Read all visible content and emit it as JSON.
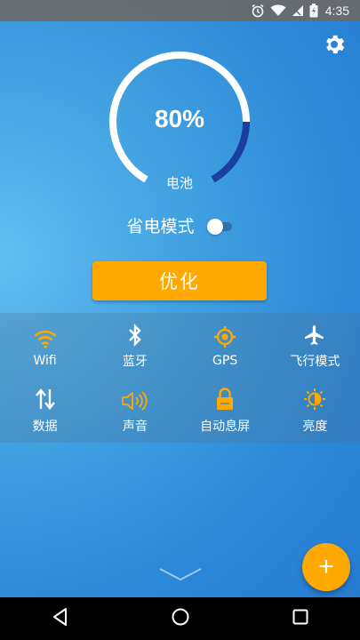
{
  "status_bar": {
    "time": "4:35",
    "icons": [
      "alarm-icon",
      "wifi-icon",
      "signal-icon",
      "battery-icon"
    ]
  },
  "settings": {
    "icon": "gear-icon"
  },
  "battery": {
    "percent_text": "80%",
    "level": 0.8,
    "label": "电池",
    "colors": {
      "track": "#ffffff",
      "fill": "#1a3fa0"
    }
  },
  "power_saving": {
    "label": "省电模式",
    "enabled": false
  },
  "optimize_button": {
    "label": "优化",
    "color": "#ffa800"
  },
  "quick_settings": [
    {
      "label": "Wifi",
      "icon": "wifi-icon",
      "color": "#ffa800"
    },
    {
      "label": "蓝牙",
      "icon": "bluetooth-icon",
      "color": "#ffffff"
    },
    {
      "label": "GPS",
      "icon": "gps-icon",
      "color": "#ffa800"
    },
    {
      "label": "飞行模式",
      "icon": "airplane-icon",
      "color": "#ffffff"
    },
    {
      "label": "数据",
      "icon": "data-transfer-icon",
      "color": "#ffffff"
    },
    {
      "label": "声音",
      "icon": "volume-icon",
      "color": "#ffa800"
    },
    {
      "label": "自动息屏",
      "icon": "lock-icon",
      "color": "#ffa800"
    },
    {
      "label": "亮度",
      "icon": "brightness-icon",
      "color": "#ffa800"
    }
  ],
  "fab": {
    "label": "+"
  },
  "nav_bar": {
    "icons": [
      "back-icon",
      "home-icon",
      "recents-icon"
    ]
  }
}
